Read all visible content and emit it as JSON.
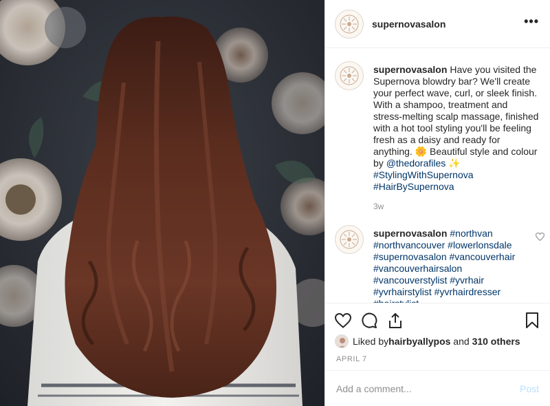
{
  "header": {
    "username": "supernovasalon",
    "more_label": "•••"
  },
  "caption": {
    "username": "supernovasalon",
    "text": "Have you visited the Supernova blowdry bar? We'll create your perfect wave, curl, or sleek finish. With a shampoo, treatment and stress-melting scalp massage, finished with a hot tool styling you'll be feeling fresh as a daisy and ready for anything. 🌼 Beautiful style and colour by ",
    "mention": "@thedorafiles",
    "sparkle": " ✨",
    "hashtag1": "#StylingWithSupernova",
    "hashtag2": "#HairBySupernova",
    "time": "3w"
  },
  "comment": {
    "username": "supernovasalon",
    "tags": "#northvan #northvancouver #lowerlonsdale #supernovasalon #vancouverhair #vancouverhairsalon #vancouverstylist #yvrhair #yvrhairstylist #yvrhairdresser #hairstylist"
  },
  "likes": {
    "prefix": "Liked by ",
    "user": "hairbyallypos",
    "middle": " and ",
    "others": "310 others"
  },
  "date": "APRIL 7",
  "add_comment": {
    "placeholder": "Add a comment...",
    "post_label": "Post"
  },
  "icons": [
    "heart-icon",
    "comment-icon",
    "share-icon",
    "bookmark-icon",
    "more-icon",
    "small-heart-icon",
    "salon-logo"
  ],
  "colors": {
    "text": "#262626",
    "muted": "#8e8e8e",
    "link": "#003569",
    "post_disabled": "#b9dffc",
    "hair": "#5a2e1f"
  }
}
